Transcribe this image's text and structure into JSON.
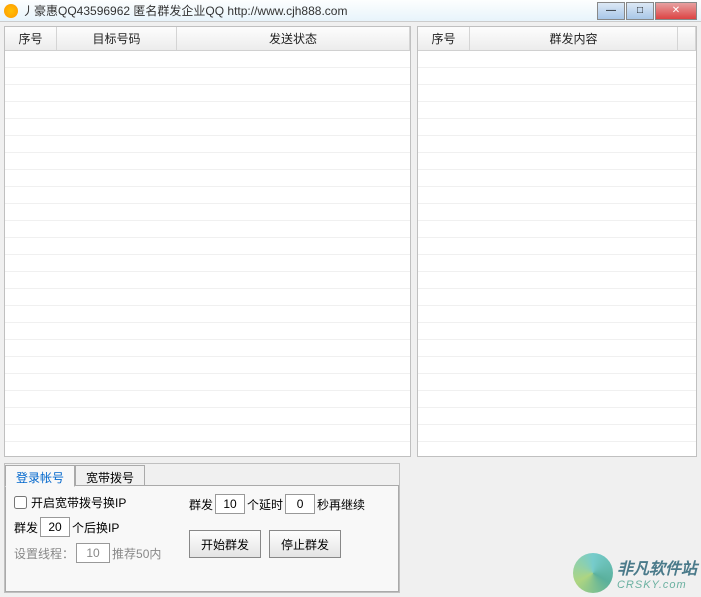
{
  "titlebar": {
    "text": "丿豪惠QQ43596962 匿名群发企业QQ    http://www.cjh888.com"
  },
  "leftTable": {
    "headers": {
      "seq": "序号",
      "target": "目标号码",
      "status": "发送状态"
    }
  },
  "rightTable": {
    "headers": {
      "seq": "序号",
      "content": "群发内容"
    }
  },
  "tabs": {
    "login": "登录帐号",
    "dial": "宽带拨号"
  },
  "settings": {
    "enableDialLabel": "开启宽带拨号换IP",
    "groupSendPrefix": "群发",
    "groupSendValue": "20",
    "groupSendSuffix": "个后换IP",
    "threadsPrefix": "设置线程：",
    "threadsValue": "10",
    "threadsHint": "推荐50内",
    "topGroupSendPrefix": "群发",
    "topGroupSendValue": "10",
    "delayLabel": "个延时",
    "delayValue": "0",
    "delaySuffix": "秒再继续",
    "startBtn": "开始群发",
    "stopBtn": "停止群发"
  },
  "watermark": {
    "cn": "非凡软件站",
    "en": "CRSKY.com"
  }
}
